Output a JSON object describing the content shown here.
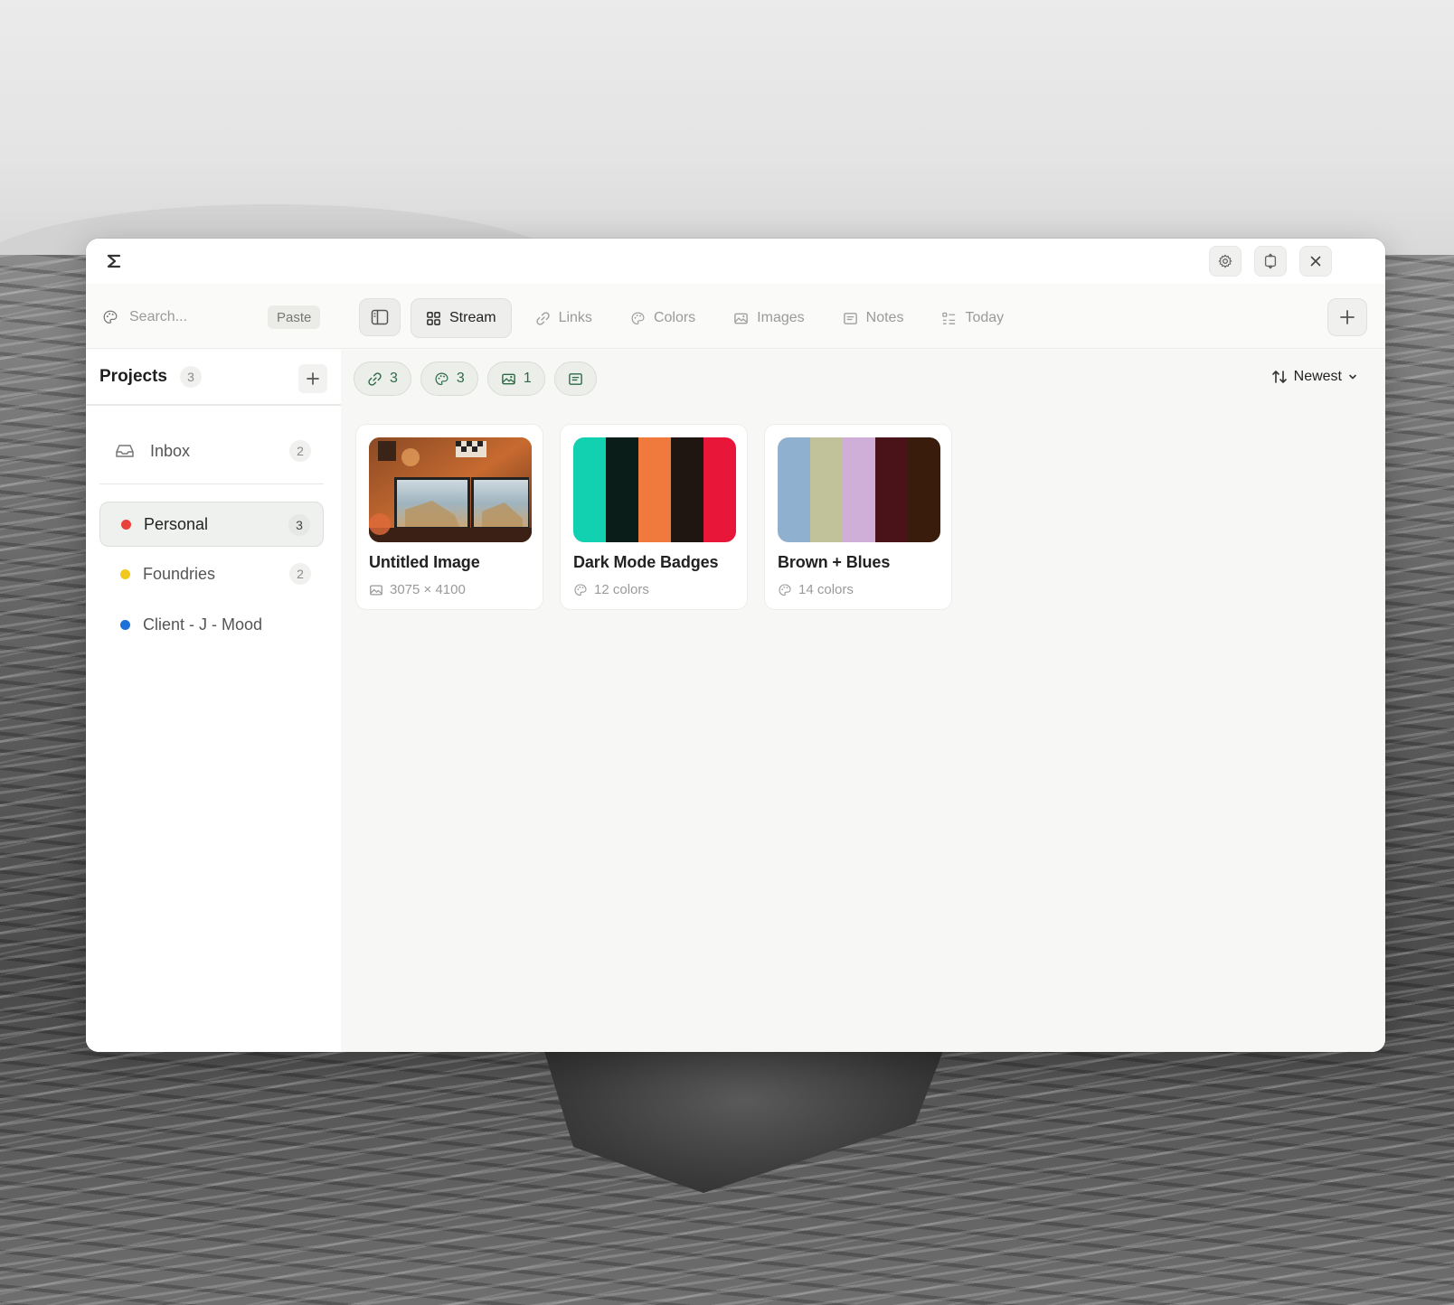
{
  "search": {
    "placeholder": "Search...",
    "paste_label": "Paste"
  },
  "tabs": [
    {
      "label": "Stream",
      "icon": "grid-icon",
      "active": true
    },
    {
      "label": "Links",
      "icon": "link-icon",
      "active": false
    },
    {
      "label": "Colors",
      "icon": "palette-icon",
      "active": false
    },
    {
      "label": "Images",
      "icon": "image-icon",
      "active": false
    },
    {
      "label": "Notes",
      "icon": "note-icon",
      "active": false
    },
    {
      "label": "Today",
      "icon": "list-icon",
      "active": false
    }
  ],
  "sidebar": {
    "title": "Projects",
    "count": "3",
    "items": [
      {
        "label": "Inbox",
        "count": "2",
        "icon": "inbox-icon"
      },
      {
        "label": "Personal",
        "count": "3",
        "dot_color": "#e8423a",
        "active": true
      },
      {
        "label": "Foundries",
        "count": "2",
        "dot_color": "#f2c91b"
      },
      {
        "label": "Client - J - Mood",
        "count": "",
        "dot_color": "#1f6fd9"
      }
    ]
  },
  "filters": [
    {
      "icon": "link-icon",
      "count": "3"
    },
    {
      "icon": "palette-icon",
      "count": "3"
    },
    {
      "icon": "image-icon",
      "count": "1"
    },
    {
      "icon": "note-icon",
      "count": ""
    }
  ],
  "sort": {
    "label": "Newest"
  },
  "cards": [
    {
      "title": "Untitled Image",
      "meta": "3075 × 4100",
      "meta_icon": "image-icon",
      "type": "image"
    },
    {
      "title": "Dark Mode Badges",
      "meta": "12 colors",
      "meta_icon": "palette-icon",
      "type": "colors",
      "swatches": [
        "#11d1b0",
        "#0a1d18",
        "#f07a3e",
        "#1f1612",
        "#e8173a"
      ]
    },
    {
      "title": "Brown + Blues",
      "meta": "14 colors",
      "meta_icon": "palette-icon",
      "type": "colors",
      "swatches": [
        "#8fb1cf",
        "#c2c29a",
        "#cfaed8",
        "#4a1219",
        "#3a1c0c"
      ]
    }
  ]
}
